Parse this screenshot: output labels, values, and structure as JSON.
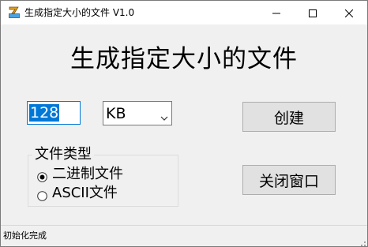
{
  "window": {
    "title": "生成指定大小的文件 V1.0",
    "app_icon": "app-logo-icon",
    "controls": {
      "minimize_icon": "minimize-icon",
      "maximize_icon": "maximize-icon",
      "close_icon": "close-icon"
    }
  },
  "main": {
    "heading": "生成指定大小的文件",
    "size_value": "128",
    "unit_selected": "KB",
    "create_button": "创建",
    "close_window_button": "关闭窗口"
  },
  "file_type": {
    "legend": "文件类型",
    "options": [
      {
        "label": "二进制文件",
        "checked": true
      },
      {
        "label": "ASCII文件",
        "checked": false
      }
    ]
  },
  "status": {
    "text": "初始化完成"
  },
  "colors": {
    "accent": "#0078d7",
    "window_bg": "#f0f0f0",
    "button_bg": "#e1e1e1"
  }
}
